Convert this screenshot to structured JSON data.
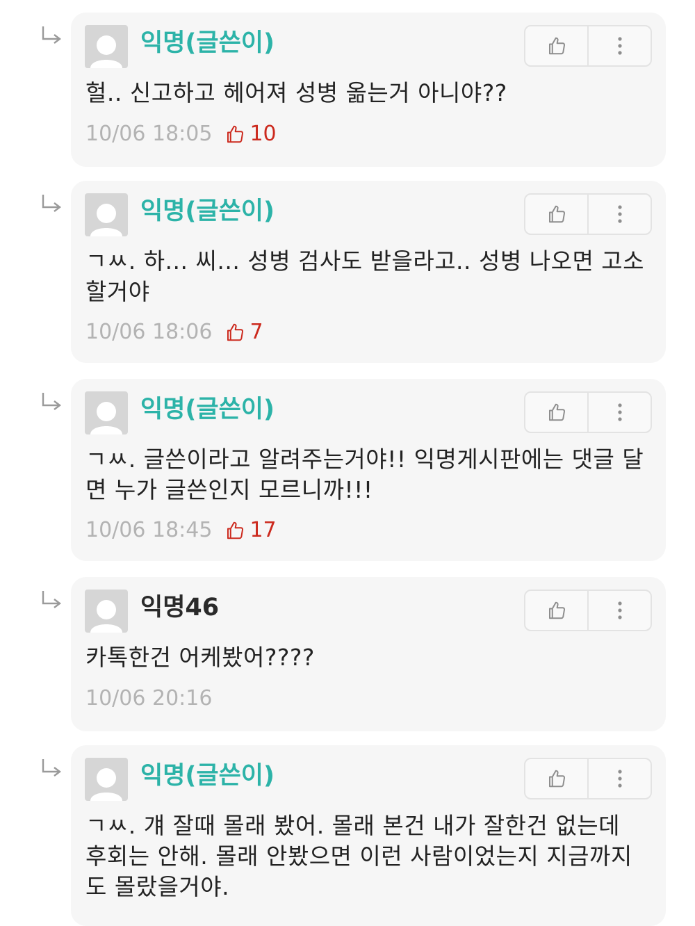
{
  "colors": {
    "op_author": "#2cb3a8",
    "author": "#2a2a2a",
    "like_count": "#cc2a1e",
    "timestamp": "#b3b3b3",
    "card_bg": "#f6f6f6"
  },
  "icons": {
    "reply": "reply-arrow-icon",
    "avatar": "default-user-icon",
    "like_button": "thumbs-up-icon",
    "more_button": "more-vertical-icon",
    "like_count": "thumbs-up-icon"
  },
  "comments": [
    {
      "author": "익명(글쓴이)",
      "body": "헐.. 신고하고 헤어져 성병 옮는거 아니야??",
      "time": "10/06 18:05",
      "likes": "10"
    },
    {
      "author": "익명(글쓴이)",
      "body": "ㄱㅆ. 하... 씨... 성병 검사도 받을라고.. 성병 나오면 고소할거야",
      "time": "10/06 18:06",
      "likes": "7"
    },
    {
      "author": "익명(글쓴이)",
      "body": "ㄱㅆ. 글쓴이라고 알려주는거야!! 익명게시판에는 댓글 달면 누가 글쓴인지 모르니까!!!",
      "time": "10/06 18:45",
      "likes": "17"
    },
    {
      "author": "익명46",
      "body": "카톡한건 어케봤어????",
      "time": "10/06 20:16",
      "likes": ""
    },
    {
      "author": "익명(글쓴이)",
      "body": "ㄱㅆ. 걔 잘때 몰래 봤어. 몰래 본건 내가 잘한건 없는데 후회는 안해. 몰래 안봤으면 이런 사람이었는지 지금까지도 몰랐을거야."
    }
  ]
}
